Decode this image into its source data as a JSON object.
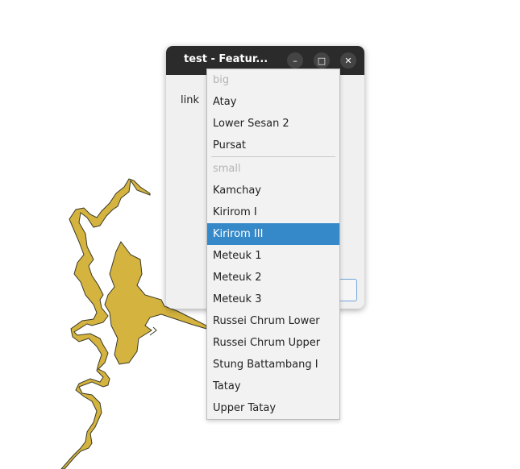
{
  "window": {
    "title": "test - Featur...",
    "field_label": "link"
  },
  "window_controls": {
    "minimize_glyph": "–",
    "maximize_glyph": "□",
    "close_glyph": "✕"
  },
  "dropdown": {
    "groups": [
      {
        "header": "big",
        "items": [
          "Atay",
          "Lower Sesan 2",
          "Pursat"
        ]
      },
      {
        "header": "small",
        "items": [
          "Kamchay",
          "Kirirom I",
          "Kirirom III",
          "Meteuk 1",
          "Meteuk 2",
          "Meteuk 3",
          "Russei Chrum Lower",
          "Russei Chrum Upper",
          "Stung Battambang I",
          "Tatay",
          "Upper Tatay"
        ]
      }
    ],
    "selected_item": "Kirirom III"
  },
  "colors": {
    "reservoir_fill": "#d4b33e",
    "selection": "#3689c9",
    "titlebar": "#2b2b2b"
  }
}
